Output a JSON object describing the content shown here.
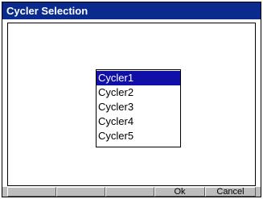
{
  "window": {
    "title": "Cycler Selection"
  },
  "list": {
    "items": [
      "Cycler1",
      "Cycler2",
      "Cycler3",
      "Cycler4",
      "Cycler5"
    ],
    "selected_index": 0
  },
  "buttons": {
    "ok_label": "Ok",
    "cancel_label": "Cancel"
  },
  "colors": {
    "titlebar": "#0a2a8e",
    "selection": "#1010a8",
    "button_face": "#bdbdbd"
  }
}
